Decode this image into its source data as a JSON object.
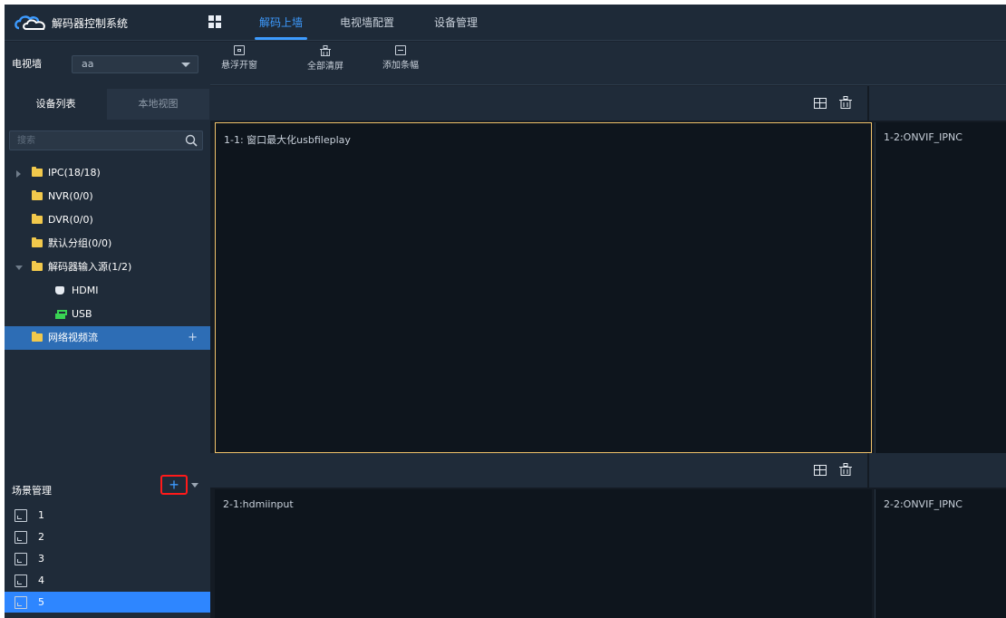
{
  "app": {
    "title": "解码器控制系统"
  },
  "nav": {
    "tabs": [
      {
        "label": "解码上墙",
        "active": true
      },
      {
        "label": "电视墙配置",
        "active": false
      },
      {
        "label": "设备管理",
        "active": false
      }
    ]
  },
  "sidebar": {
    "tv_wall_label": "电视墙",
    "tv_wall_value": "aa",
    "tabs": [
      {
        "label": "设备列表",
        "active": true
      },
      {
        "label": "本地视图",
        "active": false
      }
    ],
    "search_placeholder": "搜索",
    "tree": [
      {
        "label": "IPC(18/18)",
        "expander": "collapsed"
      },
      {
        "label": "NVR(0/0)"
      },
      {
        "label": "DVR(0/0)"
      },
      {
        "label": "默认分组(0/0)"
      },
      {
        "label": "解码器输入源(1/2)",
        "expander": "expanded"
      },
      {
        "label": "HDMI",
        "icon": "hdmi-icon"
      },
      {
        "label": "USB",
        "icon": "usb-icon"
      },
      {
        "label": "网络视频流",
        "selected": true,
        "action": "+"
      }
    ],
    "scene": {
      "title": "场景管理",
      "add_label": "+",
      "items": [
        "1",
        "2",
        "3",
        "4",
        "5"
      ],
      "selected_index": 4
    }
  },
  "toolbar": {
    "buttons": [
      {
        "label": "悬浮开窗",
        "icon": "float-window-icon"
      },
      {
        "label": "全部清屏",
        "icon": "clear-all-icon"
      },
      {
        "label": "添加条幅",
        "icon": "add-banner-icon"
      }
    ]
  },
  "wall": {
    "cells": [
      {
        "id": "1-1",
        "title": "1-1: 窗口最大化usbfileplay",
        "selected": true
      },
      {
        "id": "1-2",
        "title": "1-2:ONVIF_IPNC"
      },
      {
        "id": "2-1",
        "title": "2-1:hdmiinput"
      },
      {
        "id": "2-2",
        "title": "2-2:ONVIF_IPNC"
      }
    ]
  },
  "colors": {
    "accent": "#3d9bff",
    "selected_scene": "#2e86ff",
    "selected_tree": "#2d6db5",
    "selected_cell_border": "#f2c36b",
    "highlight_box": "#ff1a1a"
  }
}
